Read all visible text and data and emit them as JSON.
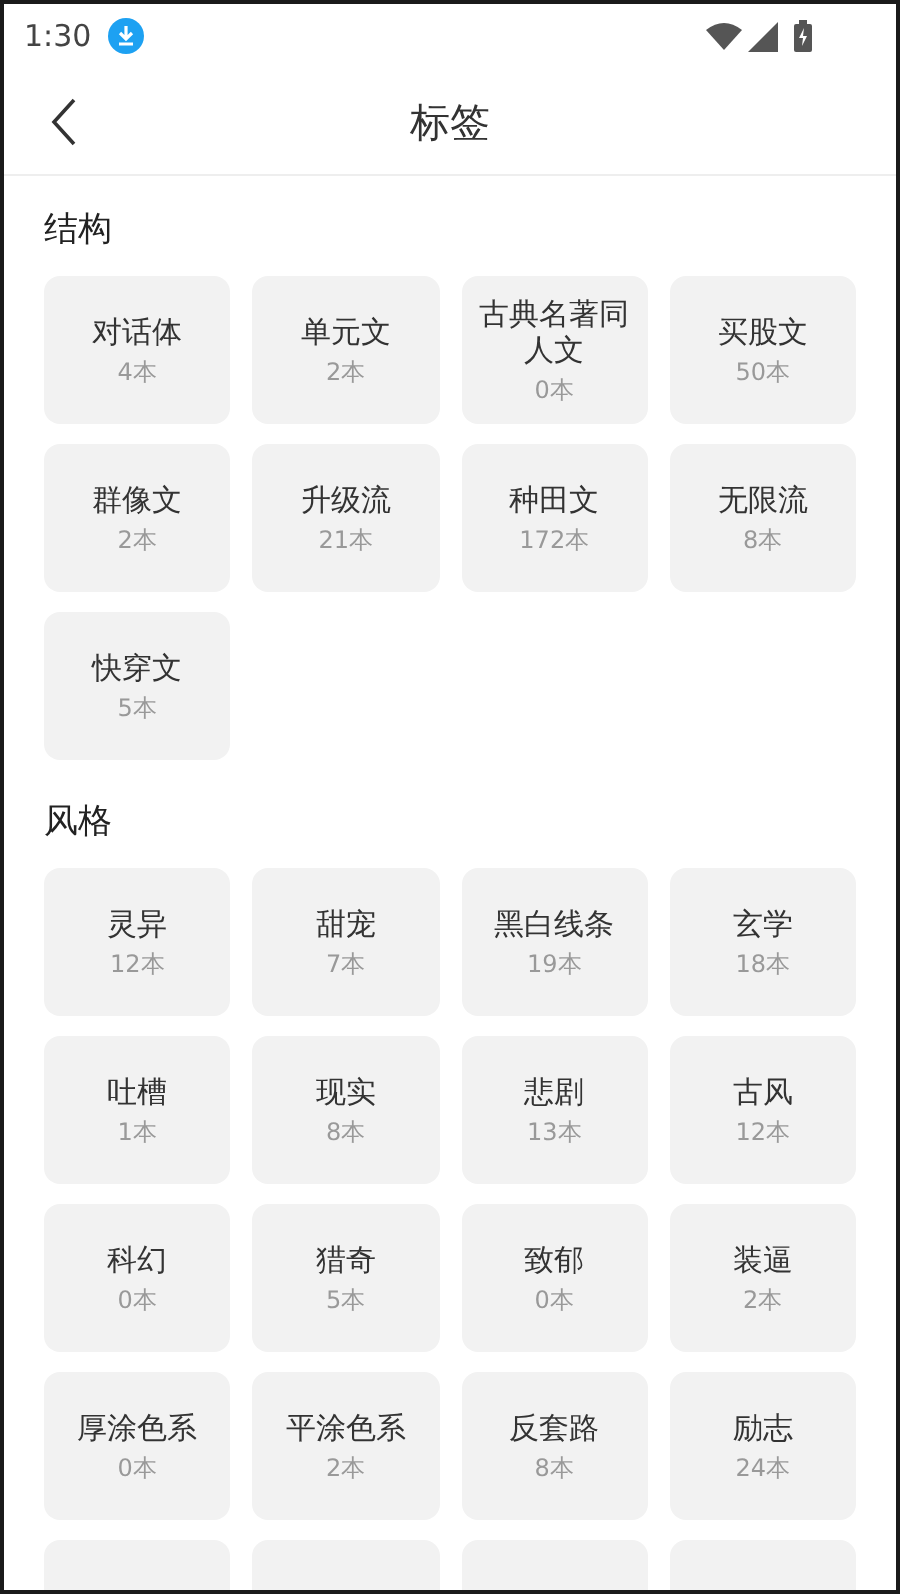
{
  "status_bar": {
    "time": "1:30"
  },
  "header": {
    "title": "标签"
  },
  "sections": [
    {
      "title": "结构",
      "tags": [
        {
          "name": "对话体",
          "count": "4本"
        },
        {
          "name": "单元文",
          "count": "2本"
        },
        {
          "name": "古典名著同人文",
          "count": "0本"
        },
        {
          "name": "买股文",
          "count": "50本"
        },
        {
          "name": "群像文",
          "count": "2本"
        },
        {
          "name": "升级流",
          "count": "21本"
        },
        {
          "name": "种田文",
          "count": "172本"
        },
        {
          "name": "无限流",
          "count": "8本"
        },
        {
          "name": "快穿文",
          "count": "5本"
        }
      ]
    },
    {
      "title": "风格",
      "tags": [
        {
          "name": "灵异",
          "count": "12本"
        },
        {
          "name": "甜宠",
          "count": "7本"
        },
        {
          "name": "黑白线条",
          "count": "19本"
        },
        {
          "name": "玄学",
          "count": "18本"
        },
        {
          "name": "吐槽",
          "count": "1本"
        },
        {
          "name": "现实",
          "count": "8本"
        },
        {
          "name": "悲剧",
          "count": "13本"
        },
        {
          "name": "古风",
          "count": "12本"
        },
        {
          "name": "科幻",
          "count": "0本"
        },
        {
          "name": "猎奇",
          "count": "5本"
        },
        {
          "name": "致郁",
          "count": "0本"
        },
        {
          "name": "装逼",
          "count": "2本"
        },
        {
          "name": "厚涂色系",
          "count": "0本"
        },
        {
          "name": "平涂色系",
          "count": "2本"
        },
        {
          "name": "反套路",
          "count": "8本"
        },
        {
          "name": "励志",
          "count": "24本"
        }
      ]
    }
  ]
}
